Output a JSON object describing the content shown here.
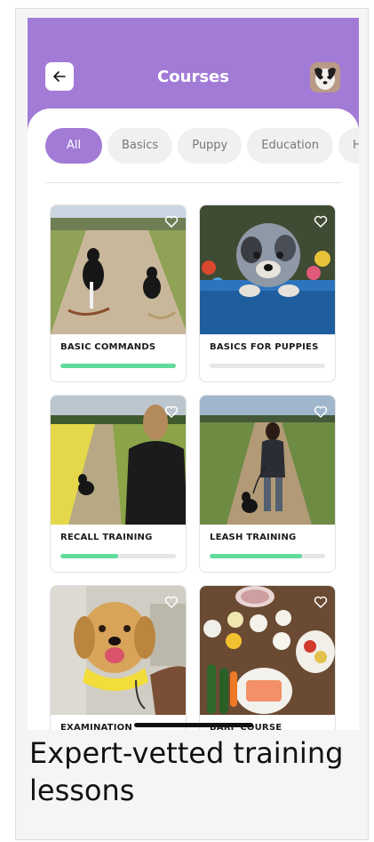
{
  "header": {
    "title": "Courses",
    "back_icon": "arrow-left-icon",
    "avatar_icon": "dog-avatar"
  },
  "filters": [
    {
      "label": "All",
      "active": true
    },
    {
      "label": "Basics",
      "active": false
    },
    {
      "label": "Puppy",
      "active": false
    },
    {
      "label": "Education",
      "active": false
    },
    {
      "label": "Heal",
      "active": false
    }
  ],
  "courses": [
    {
      "title": "BASIC COMMANDS",
      "progress": 1.0,
      "image": "two-dogs-on-path"
    },
    {
      "title": "BASICS FOR PUPPIES",
      "progress": 0.0,
      "image": "puppy-in-basket"
    },
    {
      "title": "RECALL TRAINING",
      "progress": 0.5,
      "image": "woman-with-dog-field"
    },
    {
      "title": "LEASH TRAINING",
      "progress": 0.8,
      "image": "woman-walking-dog"
    },
    {
      "title": "EXAMINATION",
      "progress": 0.0,
      "image": "golden-retriever-vet"
    },
    {
      "title": "BARF COURSE",
      "progress": 0.0,
      "image": "raw-food-table"
    }
  ],
  "caption": "Expert-vetted training lessons",
  "colors": {
    "accent": "#a27bd6",
    "progress": "#5fdb9a",
    "track": "#e6e6e6"
  }
}
